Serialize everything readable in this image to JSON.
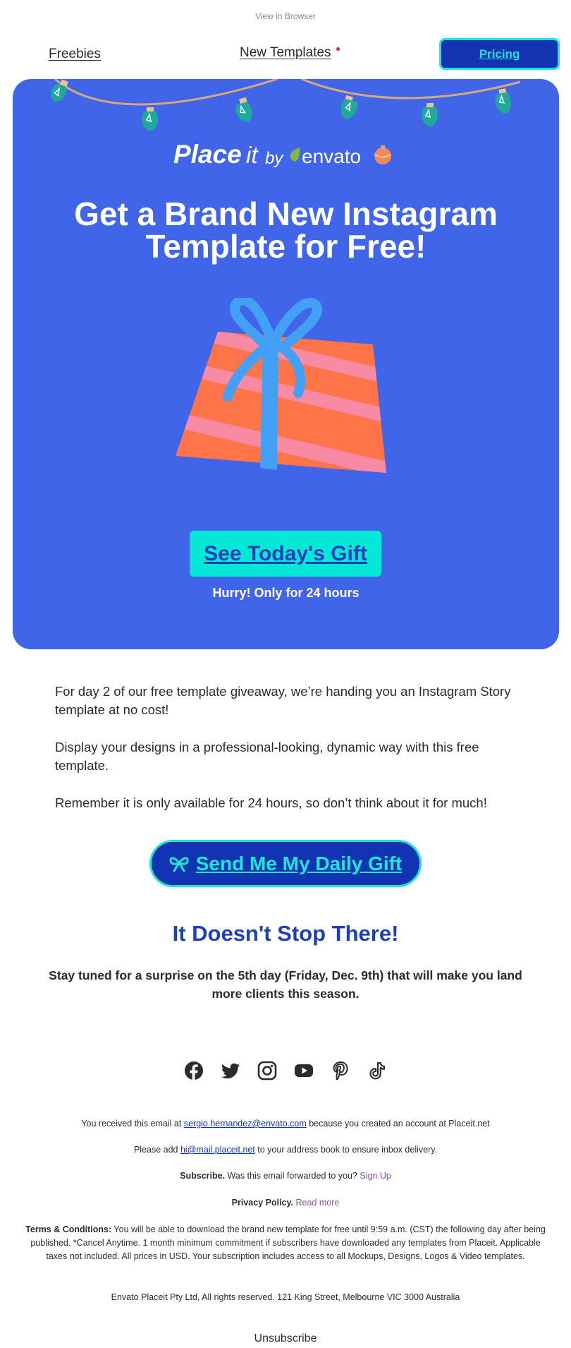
{
  "header": {
    "view_in_browser": "View in Browser"
  },
  "nav": {
    "freebies": "Freebies",
    "new_templates": "New Templates",
    "pricing": "Pricing"
  },
  "hero": {
    "logo": {
      "place": "Place",
      "it": "it",
      "by": "by",
      "envato": "envato"
    },
    "title": "Get a Brand New Instagram Template for Free!",
    "cta": "See Today's Gift",
    "urgency": "Hurry! Only for 24 hours"
  },
  "body": {
    "p1": "For day 2 of our free template giveaway, we’re handing you an Instagram Story template at no cost!",
    "p2": "Display your designs in a professional-looking, dynamic way with this free template.",
    "p3": "Remember it is only available for 24 hours, so don’t think about it for much!",
    "daily_cta": "Send Me My Daily Gift"
  },
  "teaser": {
    "title": "It Doesn't Stop There!",
    "text": "Stay tuned for a surprise on the 5th day (Friday, Dec. 9th) that will make you land more clients this season."
  },
  "social_icons": [
    "facebook-icon",
    "twitter-icon",
    "instagram-icon",
    "youtube-icon",
    "pinterest-icon",
    "tiktok-icon"
  ],
  "footer": {
    "received_pre": "You received this email at",
    "received_email": "sergio.hernandez@envato.com",
    "received_post": "because you created an account at Placeit.net",
    "add_pre": "Please add",
    "add_email": "hi@mail.placeit.net",
    "add_post": "to your address book to ensure inbox delivery.",
    "subscribe_label": "Subscribe.",
    "subscribe_text": "Was this email forwarded to you?",
    "subscribe_link": "Sign Up",
    "privacy_label": "Privacy Policy.",
    "privacy_link": "Read more",
    "terms_label": "Terms & Conditions:",
    "terms_text": "You will be able to download the brand new template for free until 9:59 a.m. (CST) the following day after being published.  *Cancel Anytime. 1 month minimum commitment if subscribers have downloaded any templates from Placeit. Applicable taxes not included. All prices in USD. Your subscription includes access to all Mockups, Designs, Logos & Video templates.",
    "company": "Envato Placeit Pty Ltd, All rights reserved. 121 King Street, Melbourne VIC 3000 Australia",
    "unsubscribe": "Unsubscribe"
  },
  "colors": {
    "hero_bg": "#4065e8",
    "brand_dark": "#1334b2",
    "accent_teal": "#1ce7d6",
    "gift_orange": "#ff7448",
    "gift_pink": "#f98aa4",
    "ribbon_blue": "#42a1f5",
    "title_blue": "#1e3fb8",
    "link_purple": "#8a52b6"
  }
}
